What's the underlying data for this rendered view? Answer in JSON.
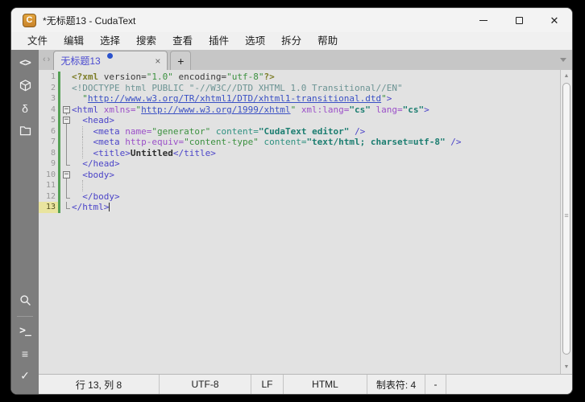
{
  "window": {
    "title": "*无标题13 - CudaText",
    "app_icon_letter": "C"
  },
  "titlebar": {
    "controls": [
      {
        "name": "minimize-button"
      },
      {
        "name": "maximize-button"
      },
      {
        "name": "close-button"
      }
    ]
  },
  "menu": {
    "items": [
      {
        "name": "menu-file",
        "label": "文件"
      },
      {
        "name": "menu-edit",
        "label": "编辑"
      },
      {
        "name": "menu-selection",
        "label": "选择"
      },
      {
        "name": "menu-search",
        "label": "搜索"
      },
      {
        "name": "menu-view",
        "label": "查看"
      },
      {
        "name": "menu-plugins",
        "label": "插件"
      },
      {
        "name": "menu-options",
        "label": "选项"
      },
      {
        "name": "menu-split",
        "label": "拆分"
      },
      {
        "name": "menu-help",
        "label": "帮助"
      }
    ]
  },
  "sidebar": {
    "top_icons": [
      {
        "name": "code-tree-icon",
        "kind": "text-mono",
        "glyph": "<>"
      },
      {
        "name": "project-cube-icon",
        "kind": "svg-cube"
      },
      {
        "name": "snippets-delta-icon",
        "kind": "text",
        "glyph": "δ"
      },
      {
        "name": "tabs-panel-icon",
        "kind": "svg-folder"
      }
    ],
    "bottom_icons": [
      {
        "name": "find-results-icon",
        "kind": "svg-search"
      },
      {
        "name": "separator",
        "kind": "sep"
      },
      {
        "name": "console-icon",
        "kind": "text-mono",
        "glyph": ">_"
      },
      {
        "name": "output-list-icon",
        "kind": "text",
        "glyph": "≡"
      },
      {
        "name": "validate-check-icon",
        "kind": "text",
        "glyph": "✓"
      }
    ]
  },
  "tabs": {
    "nav_left": "‹",
    "nav_right": "›",
    "active": {
      "label": "无标题13",
      "modified": true
    },
    "close_glyph": "×",
    "new_tab_glyph": "+"
  },
  "colors": {
    "tag": "#4b44c8",
    "attr_name": "#9b50c8",
    "attr_name2": "#2f9180",
    "string": "#3c9140",
    "value_teal": "#1b7d70",
    "link": "#3a50c4",
    "doctype": "#6b9393",
    "pi": "#7d7d28",
    "plain": "#3a3a3a",
    "text_bold": "#2e2e2e",
    "modified_bar": "#55a055",
    "tab_accent": "#4a4ad0",
    "modified_dot": "#2a52cc",
    "current_line_bg": "#e9e49f"
  },
  "editor": {
    "caret": {
      "line": 13,
      "col": 8
    },
    "lines": [
      {
        "num": 1,
        "mod": true,
        "fold": "",
        "tokens": [
          {
            "t": "<?xml",
            "c": "pi",
            "b": true
          },
          {
            "t": " version",
            "c": "plain"
          },
          {
            "t": "=",
            "c": "plain"
          },
          {
            "t": "\"1.0\"",
            "c": "string"
          },
          {
            "t": " encoding",
            "c": "plain"
          },
          {
            "t": "=",
            "c": "plain"
          },
          {
            "t": "\"utf-8\"",
            "c": "string"
          },
          {
            "t": "?>",
            "c": "pi",
            "b": true
          }
        ]
      },
      {
        "num": 2,
        "mod": true,
        "fold": "",
        "tokens": [
          {
            "t": "<!DOCTYPE html PUBLIC \"-//W3C//DTD XHTML 1.0 Transitional//EN\"",
            "c": "doctype"
          }
        ]
      },
      {
        "num": 3,
        "mod": true,
        "fold": "",
        "tokens": [
          {
            "t": "  \"",
            "c": "string"
          },
          {
            "t": "http://www.w3.org/TR/xhtml1/DTD/xhtml1-transitional.dtd",
            "c": "link",
            "u": true
          },
          {
            "t": "\"",
            "c": "string"
          },
          {
            "t": ">",
            "c": "tag"
          }
        ]
      },
      {
        "num": 4,
        "mod": true,
        "fold": "box",
        "tokens": [
          {
            "t": "<html",
            "c": "tag"
          },
          {
            "t": " ",
            "c": "plain"
          },
          {
            "t": "xmlns",
            "c": "attr_name"
          },
          {
            "t": "=",
            "c": "attr_name"
          },
          {
            "t": "\"",
            "c": "string"
          },
          {
            "t": "http://www.w3.org/1999/xhtml",
            "c": "link",
            "u": true
          },
          {
            "t": "\"",
            "c": "string"
          },
          {
            "t": " ",
            "c": "plain"
          },
          {
            "t": "xml:lang",
            "c": "attr_name"
          },
          {
            "t": "=",
            "c": "attr_name"
          },
          {
            "t": "\"cs\"",
            "c": "value_teal",
            "b": true
          },
          {
            "t": " ",
            "c": "plain"
          },
          {
            "t": "lang",
            "c": "attr_name"
          },
          {
            "t": "=",
            "c": "attr_name"
          },
          {
            "t": "\"cs\"",
            "c": "value_teal",
            "b": true
          },
          {
            "t": ">",
            "c": "tag"
          }
        ]
      },
      {
        "num": 5,
        "mod": true,
        "fold": "box",
        "tokens": [
          {
            "t": "  ",
            "c": "plain"
          },
          {
            "t": "<head>",
            "c": "tag"
          }
        ]
      },
      {
        "num": 6,
        "mod": true,
        "fold": "line",
        "guides": [
          2
        ],
        "tokens": [
          {
            "t": "    ",
            "c": "plain"
          },
          {
            "t": "<meta",
            "c": "tag"
          },
          {
            "t": " ",
            "c": "plain"
          },
          {
            "t": "name",
            "c": "attr_name"
          },
          {
            "t": "=",
            "c": "attr_name"
          },
          {
            "t": "\"generator\"",
            "c": "string"
          },
          {
            "t": " ",
            "c": "plain"
          },
          {
            "t": "content",
            "c": "attr_name2"
          },
          {
            "t": "=",
            "c": "attr_name2"
          },
          {
            "t": "\"CudaText editor\"",
            "c": "value_teal",
            "b": true
          },
          {
            "t": " ",
            "c": "plain"
          },
          {
            "t": "/>",
            "c": "tag"
          }
        ]
      },
      {
        "num": 7,
        "mod": true,
        "fold": "line",
        "guides": [
          2
        ],
        "tokens": [
          {
            "t": "    ",
            "c": "plain"
          },
          {
            "t": "<meta",
            "c": "tag"
          },
          {
            "t": " ",
            "c": "plain"
          },
          {
            "t": "http-equiv",
            "c": "attr_name"
          },
          {
            "t": "=",
            "c": "attr_name"
          },
          {
            "t": "\"content-type\"",
            "c": "string"
          },
          {
            "t": " ",
            "c": "plain"
          },
          {
            "t": "content",
            "c": "attr_name2"
          },
          {
            "t": "=",
            "c": "attr_name2"
          },
          {
            "t": "\"text/html; charset=utf-8\"",
            "c": "value_teal",
            "b": true
          },
          {
            "t": " ",
            "c": "plain"
          },
          {
            "t": "/>",
            "c": "tag"
          }
        ]
      },
      {
        "num": 8,
        "mod": true,
        "fold": "line",
        "guides": [
          2
        ],
        "tokens": [
          {
            "t": "    ",
            "c": "plain"
          },
          {
            "t": "<title>",
            "c": "tag"
          },
          {
            "t": "Untitled",
            "c": "text_bold",
            "b": true
          },
          {
            "t": "</title>",
            "c": "tag"
          }
        ]
      },
      {
        "num": 9,
        "mod": true,
        "fold": "end",
        "tokens": [
          {
            "t": "  ",
            "c": "plain"
          },
          {
            "t": "</head>",
            "c": "tag"
          }
        ]
      },
      {
        "num": 10,
        "mod": true,
        "fold": "box",
        "tokens": [
          {
            "t": "  ",
            "c": "plain"
          },
          {
            "t": "<body>",
            "c": "tag"
          }
        ]
      },
      {
        "num": 11,
        "mod": true,
        "fold": "line",
        "guides": [
          2
        ],
        "tokens": []
      },
      {
        "num": 12,
        "mod": true,
        "fold": "end",
        "tokens": [
          {
            "t": "  ",
            "c": "plain"
          },
          {
            "t": "</body>",
            "c": "tag"
          }
        ]
      },
      {
        "num": 13,
        "mod": true,
        "cur": true,
        "fold": "end",
        "caret": true,
        "tokens": [
          {
            "t": "</html>",
            "c": "tag"
          }
        ]
      }
    ]
  },
  "scrollbar": {
    "up_glyph": "▲",
    "down_glyph": "▼",
    "grip_glyph": "≡"
  },
  "statusbar": {
    "cells": [
      {
        "name": "status-caret-position",
        "label": "行 13, 列 8"
      },
      {
        "name": "status-encoding",
        "label": "UTF-8"
      },
      {
        "name": "status-line-endings",
        "label": "LF"
      },
      {
        "name": "status-lexer",
        "label": "HTML"
      },
      {
        "name": "status-tab-size",
        "label": "制表符: 4"
      },
      {
        "name": "status-wrap",
        "label": "-"
      }
    ]
  }
}
